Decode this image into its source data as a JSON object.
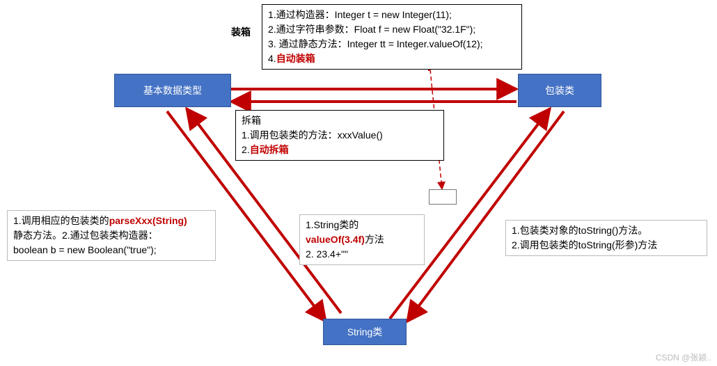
{
  "nodes": {
    "primitive": "基本数据类型",
    "wrapper": "包装类",
    "string": "String类"
  },
  "labels": {
    "box_label": "装箱"
  },
  "boxing": {
    "l1": "1.通过构造器：Integer t = new Integer(11);",
    "l2": "2.通过字符串参数：Float f = new Float(\"32.1F\");",
    "l3": "3. 通过静态方法：Integer tt = Integer.valueOf(12);",
    "l4_prefix": "4.",
    "l4_red": "自动装箱"
  },
  "unboxing": {
    "l1": "拆箱",
    "l2": "1.调用包装类的方法：xxxValue()",
    "l3_prefix": "2.",
    "l3_red": "自动拆箱"
  },
  "string_to_primitive": {
    "l1_a": "1.调用相应的包装类的",
    "l1_red": "parseXxx(String)",
    "l2": "静态方法。2.通过包装类构造器：",
    "l3": "boolean b = new Boolean(\"true\");"
  },
  "primitive_to_string": {
    "l1": "1.String类的",
    "l2_red": "valueOf(3.4f)",
    "l2_suffix": "方法",
    "l3": "2. 23.4+\"\""
  },
  "wrapper_to_string": {
    "l1": "1.包装类对象的toString()方法。",
    "l2": "2.调用包装类的toString(形参)方法"
  },
  "watermark": "CSDN @张颍.."
}
